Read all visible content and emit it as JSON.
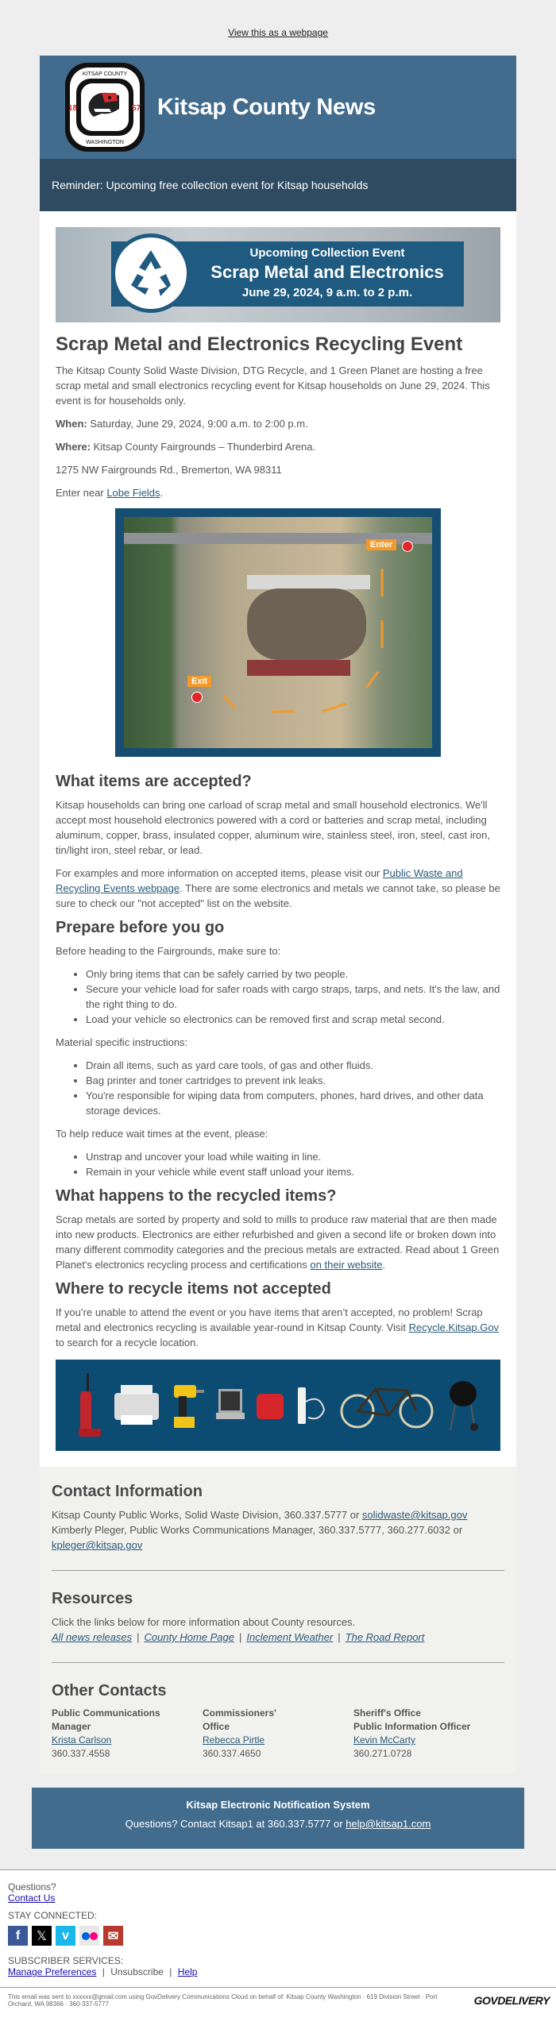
{
  "header": {
    "view_webpage_link": "View this as a webpage",
    "logo": {
      "top_text": "KITSAP COUNTY",
      "bottom_text": "WASHINGTON",
      "year_left": "18",
      "year_right": "57"
    },
    "title": "Kitsap County News",
    "reminder": "Reminder: Upcoming free collection event for Kitsap households"
  },
  "banner": {
    "line1": "Upcoming Collection Event",
    "line2": "Scrap Metal and Electronics",
    "line3": "June 29, 2024, 9 a.m. to 2 p.m."
  },
  "article": {
    "title": "Scrap Metal and Electronics Recycling Event",
    "intro": "The Kitsap County Solid Waste Division, DTG Recycle, and 1 Green Planet are hosting a free scrap metal and small electronics recycling event for Kitsap households on June 29, 2024. This event is for households only.",
    "when_label": "When:",
    "when_value": " Saturday, June 29, 2024, 9:00 a.m. to 2:00 p.m.",
    "where_label": "Where:",
    "where_value": " Kitsap County Fairgrounds – Thunderbird Arena.",
    "address": "1275 NW Fairgrounds Rd., Bremerton, WA 98311",
    "enter_prefix": "Enter near ",
    "enter_link": "Lobe Fields",
    "enter_suffix": ".",
    "map": {
      "enter_label": "Enter",
      "exit_label": "Exit"
    },
    "accepted": {
      "heading": "What items are accepted?",
      "p1": "Kitsap households can bring one carload of scrap metal and small household electronics. We'll accept most household electronics powered with a cord or batteries and scrap metal, including aluminum, copper, brass, insulated copper, aluminum wire, stainless steel, iron, steel, cast iron, tin/light iron, steel rebar, or lead.",
      "p2_prefix": "For examples and more information on accepted items, please visit our ",
      "p2_link": "Public Waste and Recycling Events webpage",
      "p2_suffix": ". There are some electronics and metals we cannot take, so please be sure to check our \"not accepted\" list on the website."
    },
    "prepare": {
      "heading": "Prepare before you go",
      "intro": "Before heading to the Fairgrounds, make sure to:",
      "list1": [
        "Only bring items that can be safely carried by two people.",
        "Secure your vehicle load for safer roads with cargo straps, tarps, and nets. It's the law, and the right thing to do.",
        "Load your vehicle so electronics can be removed first and scrap metal second."
      ],
      "material_intro": "Material specific instructions:",
      "list2": [
        "Drain all items, such as yard care tools, of gas and other fluids.",
        "Bag printer and toner cartridges to prevent ink leaks.",
        "You're responsible for wiping data from computers, phones, hard drives, and other data storage devices."
      ],
      "wait_intro": "To help reduce wait times at the event, please:",
      "list3": [
        "Unstrap and uncover your load while waiting in line.",
        "Remain in your vehicle while event staff unload your items."
      ]
    },
    "recycled": {
      "heading": "What happens to the recycled items?",
      "text": "Scrap metals are sorted by property and sold to mills to produce raw material that are then made into new products. Electronics are either refurbished and given a second life or broken down into many different commodity categories and the precious metals are extracted. Read about 1 Green Planet's electronics recycling process and certifications ",
      "link": "on their website",
      "suffix": "."
    },
    "not_accepted": {
      "heading": "Where to recycle items not accepted",
      "text": "If you’re unable to attend the event or you have items that aren’t accepted, no problem! Scrap metal and electronics recycling is available year-round in Kitsap County. Visit ",
      "link": "Recycle.Kitsap.Gov",
      "suffix": " to search for a recycle location."
    }
  },
  "contact": {
    "heading": "Contact Information",
    "line1_text": "Kitsap County Public Works, Solid Waste Division, 360.337.5777 or ",
    "line1_email": "solidwaste@kitsap.gov",
    "line2_text": "Kimberly Pleger, Public Works Communications Manager, 360.337.5777, 360.277.6032 or ",
    "line2_email": "kpleger@kitsap.gov"
  },
  "resources": {
    "heading": "Resources",
    "intro": "Click the links below for more information about County resources.",
    "links": [
      "All news releases",
      "County Home Page",
      "Inclement Weather",
      "The Road Report"
    ],
    "separator": "|"
  },
  "other_contacts": {
    "heading": "Other Contacts",
    "columns": [
      {
        "role_line1": "Public Communications",
        "role_line2": "Manager",
        "name": "Krista Carlson",
        "phone": "360.337.4558"
      },
      {
        "role_line1": "Commissioners'",
        "role_line2": "Office",
        "name": "Rebecca Pirtle",
        "phone": "360.337.4650"
      },
      {
        "role_line1": "Sheriff's Office",
        "role_line2": "Public Information Officer",
        "name": "Kevin McCarty",
        "phone": "360.271.0728"
      }
    ]
  },
  "kens": {
    "title": "Kitsap Electronic Notification System",
    "text": "Questions? Contact Kitsap1 at 360.337.5777 or ",
    "email": "help@kitsap1.com"
  },
  "govdelivery": {
    "questions": "Questions?",
    "contact_us": "Contact Us",
    "stay_connected": "STAY CONNECTED:",
    "social": [
      "facebook-icon",
      "x-icon",
      "vimeo-icon",
      "flickr-icon",
      "email-icon"
    ],
    "subscriber_services": "SUBSCRIBER SERVICES:",
    "manage_preferences": "Manage Preferences",
    "unsubscribe": "Unsubscribe",
    "help": "Help",
    "sep": "|",
    "footer_text": "This email was sent to xxxxxx@gmail.com using GovDelivery Communications Cloud on behalf of: Kitsap County Washington · 619 Division Street · Port Orchard, WA 98366 · 360-337-5777",
    "logo": "GOVDELIVERY"
  },
  "colors": {
    "masthead": "#426c8e",
    "reminder_bar": "#2f4b62",
    "banner_blue": "#1f5a80",
    "items_banner": "#0d4c72",
    "link": "#2a5a78"
  }
}
